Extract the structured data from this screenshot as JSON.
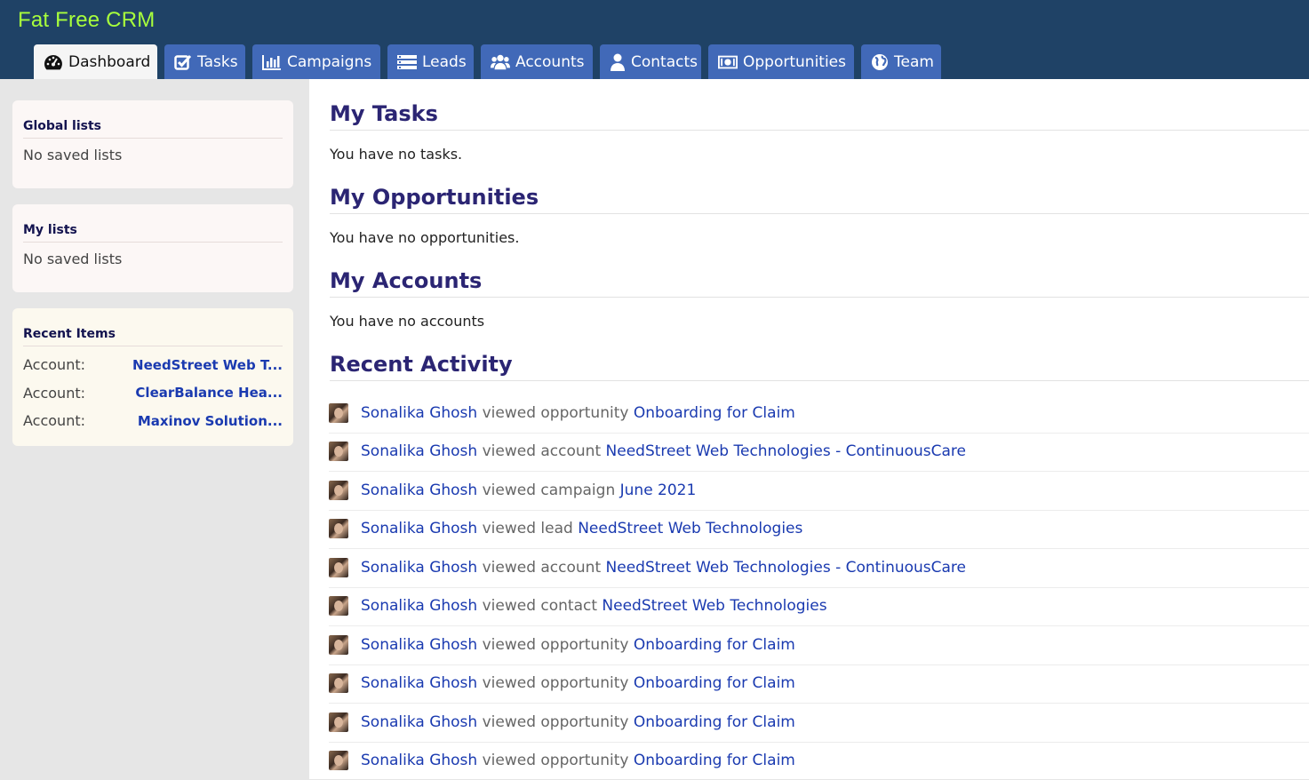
{
  "app": {
    "brand": "Fat Free CRM"
  },
  "nav": {
    "tabs": [
      {
        "label": "Dashboard",
        "icon": "tachometer-icon",
        "active": true
      },
      {
        "label": "Tasks",
        "icon": "checkbox-icon"
      },
      {
        "label": "Campaigns",
        "icon": "bar-chart-icon"
      },
      {
        "label": "Leads",
        "icon": "list-icon"
      },
      {
        "label": "Accounts",
        "icon": "users-icon"
      },
      {
        "label": "Contacts",
        "icon": "user-icon"
      },
      {
        "label": "Opportunities",
        "icon": "money-icon"
      },
      {
        "label": "Team",
        "icon": "globe-icon"
      }
    ]
  },
  "sidebar": {
    "global_lists": {
      "title": "Global lists",
      "empty": "No saved lists"
    },
    "my_lists": {
      "title": "My lists",
      "empty": "No saved lists"
    },
    "recent_items": {
      "title": "Recent Items",
      "items": [
        {
          "label": "Account:",
          "value": "NeedStreet Web T..."
        },
        {
          "label": "Account:",
          "value": "ClearBalance Hea..."
        },
        {
          "label": "Account:",
          "value": "Maxinov Solution..."
        }
      ]
    }
  },
  "main": {
    "tasks": {
      "title": "My Tasks",
      "empty": "You have no tasks."
    },
    "opportunities": {
      "title": "My Opportunities",
      "empty": "You have no opportunities."
    },
    "accounts": {
      "title": "My Accounts",
      "empty": "You have no accounts"
    },
    "recent_activity": {
      "title": "Recent Activity",
      "items": [
        {
          "user": "Sonalika Ghosh",
          "verb": "viewed opportunity",
          "target": "Onboarding for Claim"
        },
        {
          "user": "Sonalika Ghosh",
          "verb": "viewed account",
          "target": "NeedStreet Web Technologies - ContinuousCare"
        },
        {
          "user": "Sonalika Ghosh",
          "verb": "viewed campaign",
          "target": "June 2021"
        },
        {
          "user": "Sonalika Ghosh",
          "verb": "viewed lead",
          "target": "NeedStreet Web Technologies"
        },
        {
          "user": "Sonalika Ghosh",
          "verb": "viewed account",
          "target": "NeedStreet Web Technologies - ContinuousCare"
        },
        {
          "user": "Sonalika Ghosh",
          "verb": "viewed contact",
          "target": "NeedStreet Web Technologies"
        },
        {
          "user": "Sonalika Ghosh",
          "verb": "viewed opportunity",
          "target": "Onboarding for Claim"
        },
        {
          "user": "Sonalika Ghosh",
          "verb": "viewed opportunity",
          "target": "Onboarding for Claim"
        },
        {
          "user": "Sonalika Ghosh",
          "verb": "viewed opportunity",
          "target": "Onboarding for Claim"
        },
        {
          "user": "Sonalika Ghosh",
          "verb": "viewed opportunity",
          "target": "Onboarding for Claim"
        }
      ]
    }
  },
  "colors": {
    "header_bg": "#1f4266",
    "brand": "#a8ff3c",
    "tab_bg": "#4169b8",
    "link": "#1a3ab0",
    "section_title": "#2b2573"
  }
}
